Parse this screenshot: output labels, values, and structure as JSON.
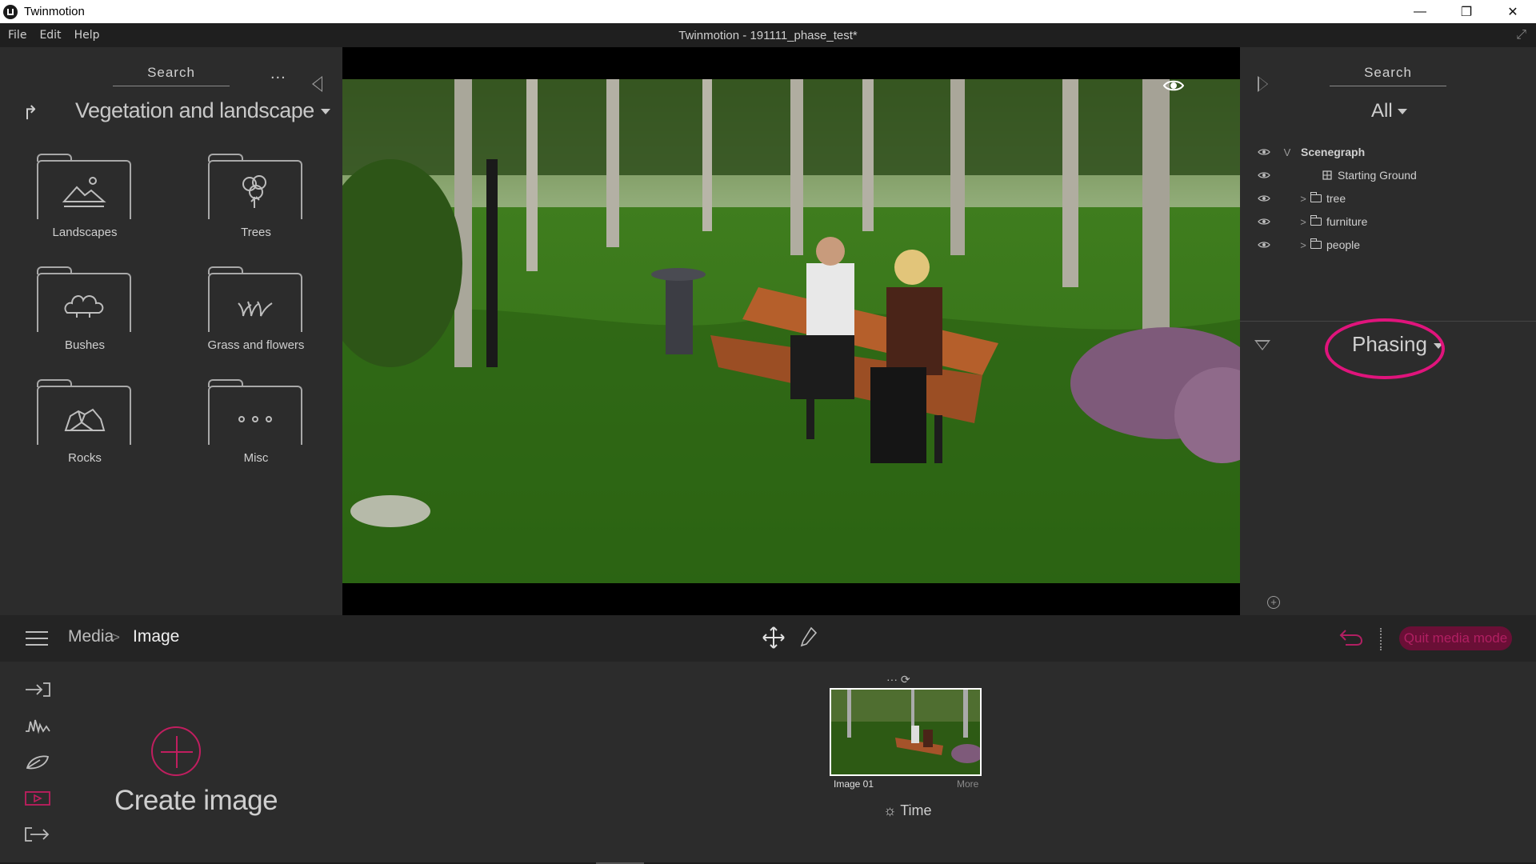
{
  "window": {
    "app_title": "Twinmotion",
    "document_title": "Twinmotion - 191111_phase_test*",
    "controls": [
      "minimize",
      "restore",
      "close"
    ]
  },
  "menu": {
    "items": [
      "File",
      "Edit",
      "Help"
    ]
  },
  "library": {
    "search_label": "Search",
    "more_label": "...",
    "category": "Vegetation and landscape",
    "folders": [
      {
        "label": "Landscapes",
        "icon": "landscape-icon"
      },
      {
        "label": "Trees",
        "icon": "tree-icon"
      },
      {
        "label": "Bushes",
        "icon": "bush-icon"
      },
      {
        "label": "Grass and flowers",
        "icon": "grass-icon"
      },
      {
        "label": "Rocks",
        "icon": "rock-icon"
      },
      {
        "label": "Misc",
        "icon": "misc-icon"
      }
    ]
  },
  "scene": {
    "search_label": "Search",
    "filter": "All",
    "tree": [
      {
        "label": "Scenegraph",
        "expander": "V",
        "bold": true,
        "icon": "none"
      },
      {
        "label": "Starting Ground",
        "expander": "",
        "bold": false,
        "icon": "ground-icon"
      },
      {
        "label": "tree",
        "expander": ">",
        "bold": false,
        "icon": "folder-icon"
      },
      {
        "label": "furniture",
        "expander": ">",
        "bold": false,
        "icon": "folder-icon"
      },
      {
        "label": "people",
        "expander": ">",
        "bold": false,
        "icon": "folder-icon"
      }
    ],
    "phasing_label": "Phasing",
    "highlight_color": "#e0147c"
  },
  "toolbar": {
    "breadcrumb_media": "Media",
    "breadcrumb_sep": ">",
    "breadcrumb_image": "Image",
    "quit_label": "Quit media mode",
    "accent": "#b11f62"
  },
  "media": {
    "create_label": "Create image",
    "thumb_tools": "··· ⟳",
    "image_label": "Image 01",
    "more_label": "More",
    "time_label": "Time"
  }
}
